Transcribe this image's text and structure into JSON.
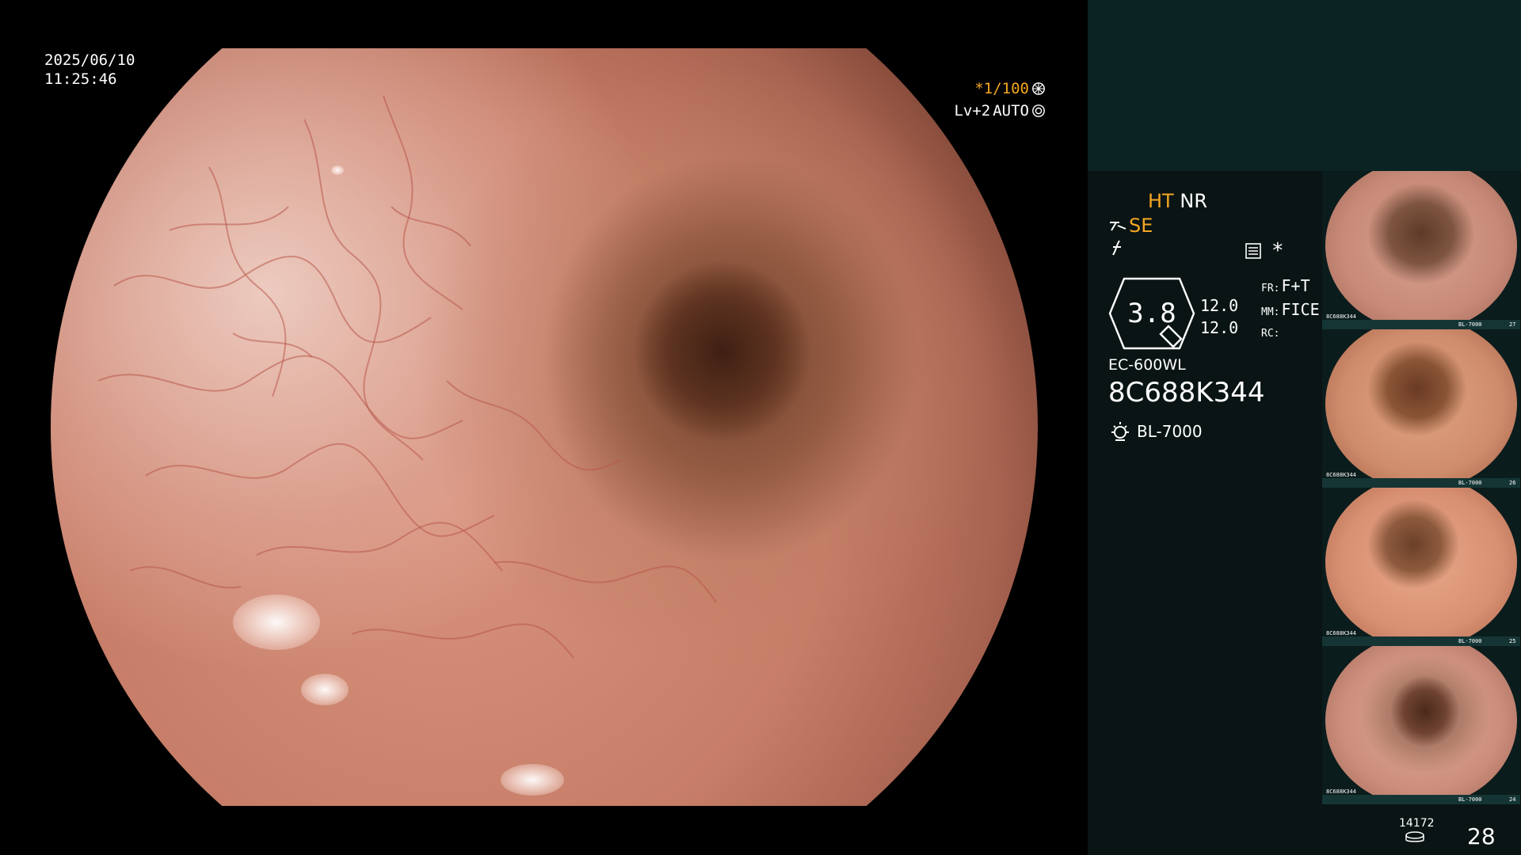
{
  "overlay": {
    "date": "2025/06/10",
    "time": "11:25:46",
    "shutter": "*1/100",
    "level": "Lv+2",
    "iris_mode": "AUTO"
  },
  "panel": {
    "ht": "HT",
    "nr": "NR",
    "se": "SE",
    "zoom_value": "3.8",
    "value_1": "12.0",
    "value_2": "12.0",
    "fr_label": "FR:",
    "fr_value": "F+T",
    "mm_label": "MM:",
    "mm_value": "FICE",
    "rc_label": "RC:",
    "scope_model": "EC-600WL",
    "scope_serial": "8C688K344",
    "light_source": "BL-7000"
  },
  "thumbnails": [
    {
      "serial": "8C688K344",
      "light": "BL-7000",
      "number": "27"
    },
    {
      "serial": "8C688K344",
      "light": "BL-7000",
      "number": "26"
    },
    {
      "serial": "8C688K344",
      "light": "BL-7000",
      "number": "25"
    },
    {
      "serial": "8C688K344",
      "light": "BL-7000",
      "number": "24"
    }
  ],
  "storage": {
    "remaining": "14172",
    "count": "28"
  },
  "colors": {
    "accent_orange": "#f5a623",
    "panel_bg": "#0a1414",
    "panel_top_bg": "#0b2323"
  }
}
